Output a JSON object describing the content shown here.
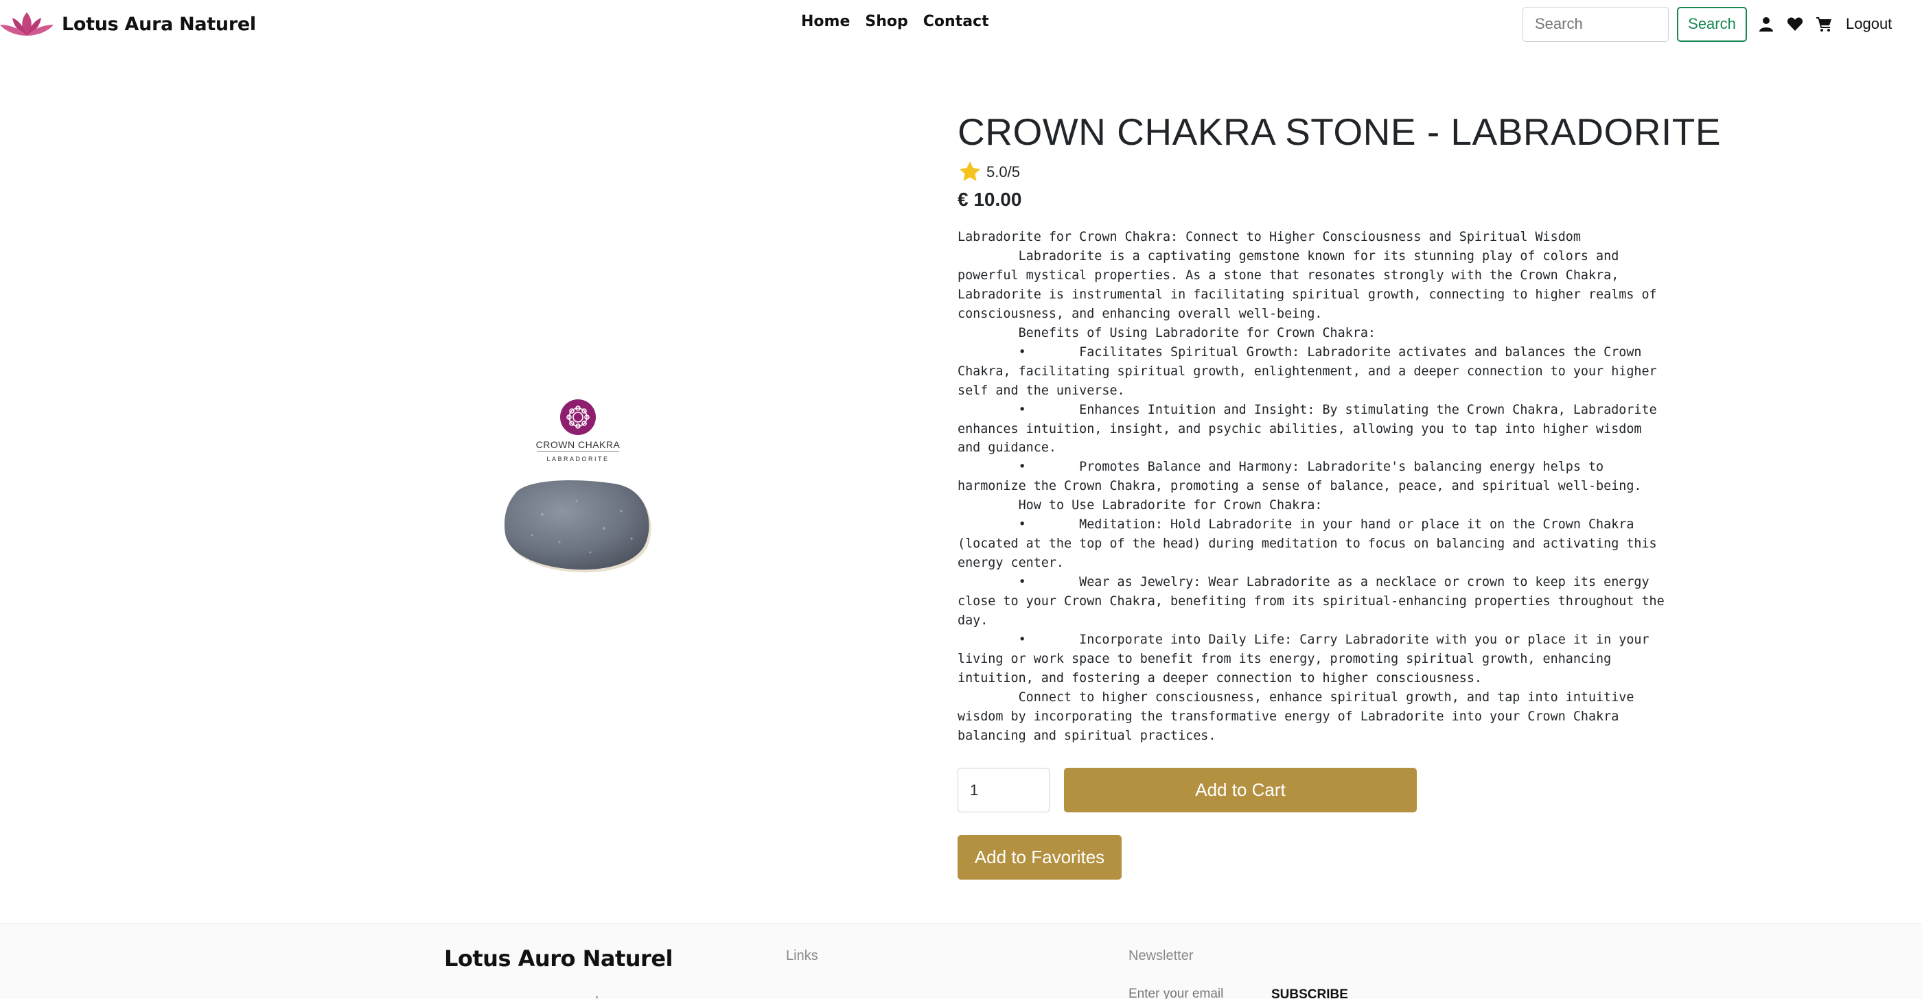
{
  "nav": {
    "brand": "Lotus Aura Naturel",
    "links": [
      "Home",
      "Shop",
      "Contact"
    ],
    "search_placeholder": "Search",
    "search_button": "Search",
    "logout": "Logout",
    "icons": [
      "user-icon",
      "heart-icon",
      "cart-icon"
    ]
  },
  "product": {
    "image": {
      "badge_title": "CROWN CHAKRA",
      "badge_subtitle": "LABRADORITE"
    },
    "title": "CROWN CHAKRA STONE - LABRADORITE",
    "rating": "5.0/5",
    "price": "€ 10.00",
    "description": "Labradorite for Crown Chakra: Connect to Higher Consciousness and Spiritual Wisdom\n\tLabradorite is a captivating gemstone known for its stunning play of colors and powerful mystical properties. As a stone that resonates strongly with the Crown Chakra, Labradorite is instrumental in facilitating spiritual growth, connecting to higher realms of consciousness, and enhancing overall well-being.\n\tBenefits of Using Labradorite for Crown Chakra:\n\t•\tFacilitates Spiritual Growth: Labradorite activates and balances the Crown Chakra, facilitating spiritual growth, enlightenment, and a deeper connection to your higher self and the universe.\n\t•\tEnhances Intuition and Insight: By stimulating the Crown Chakra, Labradorite enhances intuition, insight, and psychic abilities, allowing you to tap into higher wisdom and guidance.\n\t•\tPromotes Balance and Harmony: Labradorite's balancing energy helps to harmonize the Crown Chakra, promoting a sense of balance, peace, and spiritual well-being.\n\tHow to Use Labradorite for Crown Chakra:\n\t•\tMeditation: Hold Labradorite in your hand or place it on the Crown Chakra (located at the top of the head) during meditation to focus on balancing and activating this energy center.\n\t•\tWear as Jewelry: Wear Labradorite as a necklace or crown to keep its energy close to your Crown Chakra, benefiting from its spiritual-enhancing properties throughout the day.\n\t•\tIncorporate into Daily Life: Carry Labradorite with you or place it in your living or work space to benefit from its energy, promoting spiritual growth, enhancing intuition, and fostering a deeper connection to higher consciousness.\n\tConnect to higher consciousness, enhance spiritual growth, and tap into intuitive wisdom by incorporating the transformative energy of Labradorite into your Crown Chakra balancing and spiritual practices.",
    "quantity": "1",
    "add_to_cart": "Add to Cart",
    "add_to_favorites": "Add to Favorites"
  },
  "footer": {
    "brand": "Lotus Auro Naturel",
    "links_heading": "Links",
    "newsletter_heading": "Newsletter",
    "email_placeholder": "Enter your email",
    "subscribe": "SUBSCRIBE"
  },
  "colors": {
    "accent": "#b39140",
    "search_green": "#198754",
    "lotus_pink": "#c2447e",
    "badge_purple": "#8e1e6e",
    "star": "#f4c31f"
  }
}
